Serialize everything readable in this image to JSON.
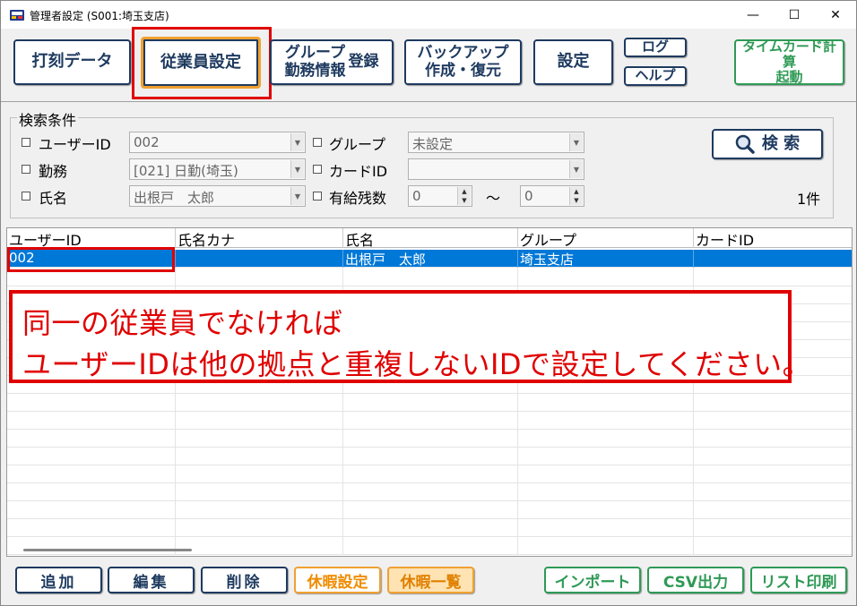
{
  "window": {
    "title": "管理者設定 (S001:埼玉支店)",
    "minimize": "—",
    "maximize": "☐",
    "close": "✕"
  },
  "toolbar": {
    "punch_data": "打刻データ",
    "employee_settings": "従業員設定",
    "group_line1": "グループ",
    "group_line2": "勤務情報",
    "group_register": "登録",
    "backup_line1": "バックアップ",
    "backup_line2": "作成・復元",
    "settings": "設定",
    "log": "ログ",
    "help": "ヘルプ",
    "timecard_line1": "タイムカード計算",
    "timecard_line2": "起動"
  },
  "search": {
    "group_label": "検索条件",
    "user_id_label": "ユーザーID",
    "user_id_value": "002",
    "duty_label": "勤務",
    "duty_value": "[021] 日勤(埼玉)",
    "name_label": "氏名",
    "name_value": "出根戸　太郎",
    "group_label2": "グループ",
    "group_value": "未設定",
    "card_id_label": "カードID",
    "card_id_value": "",
    "paid_leave_label": "有給残数",
    "paid_leave_from": "0",
    "tilde": "～",
    "paid_leave_to": "0",
    "search_button": "検 索",
    "result_count": "1件"
  },
  "list": {
    "columns": [
      "ユーザーID",
      "氏名カナ",
      "氏名",
      "グループ",
      "カードID"
    ],
    "rows": [
      {
        "user_id": "002",
        "kana": "",
        "name": "出根戸　太郎",
        "group": "埼玉支店",
        "card_id": ""
      }
    ]
  },
  "callout": {
    "line1": "同一の従業員でなければ",
    "line2": "ユーザーIDは他の拠点と重複しないIDで設定してください。"
  },
  "bottom": {
    "add": "追加",
    "edit": "編集",
    "delete": "削除",
    "leave_settings": "休暇設定",
    "leave_list": "休暇一覧",
    "import": "インポート",
    "csv_export": "CSV出力",
    "list_print": "リスト印刷"
  },
  "colors": {
    "navy": "#1e3a5f",
    "green": "#2e9a55",
    "orange": "#f0a030",
    "selection": "#0078d7",
    "alert_red": "#e00000"
  }
}
